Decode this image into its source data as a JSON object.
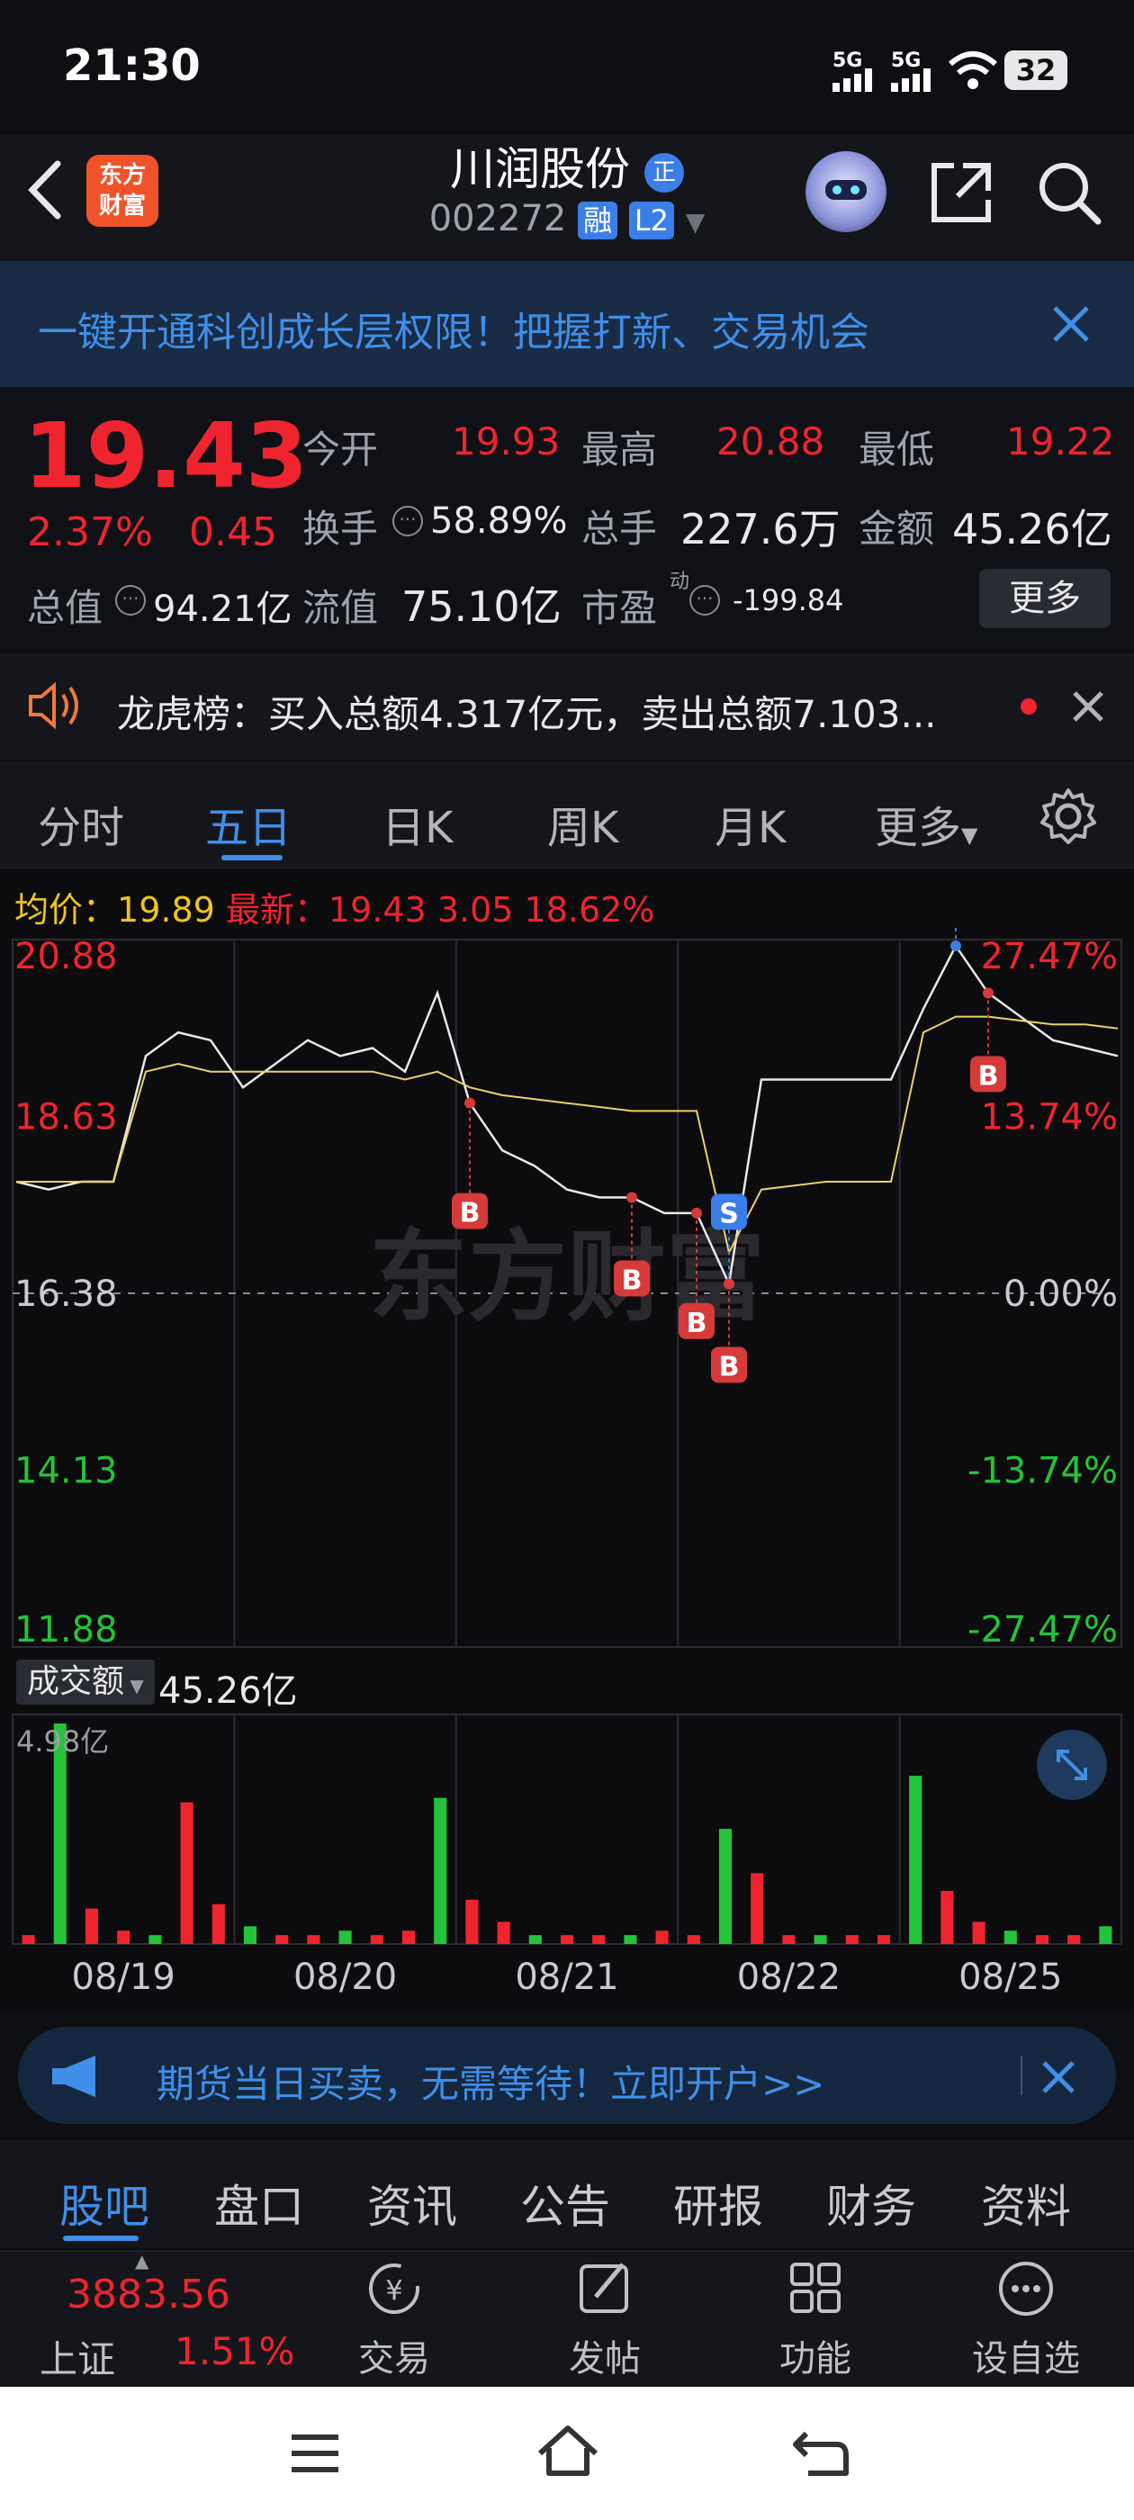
{
  "status": {
    "time": "21:30",
    "battery": "32",
    "net1": "5G",
    "net2": "5G"
  },
  "header": {
    "logo_line1": "东方",
    "logo_line2": "财富",
    "title": "川润股份",
    "title_badge": "正",
    "code": "002272",
    "tag_rong": "融",
    "tag_l2": "L2"
  },
  "banner": {
    "text": "一键开通科创成长层权限！把握打新、交易机会"
  },
  "quote": {
    "price": "19.43",
    "change_pct": "2.37%",
    "change": "0.45",
    "open_label": "今开",
    "open": "19.93",
    "high_label": "最高",
    "high": "20.88",
    "low_label": "最低",
    "low": "19.22",
    "turnover_label": "换手",
    "turnover": "58.89%",
    "volume_label": "总手",
    "volume": "227.6万",
    "amount_label": "金额",
    "amount": "45.26亿",
    "mktcap_label": "总值",
    "mktcap": "94.21亿",
    "float_label": "流值",
    "float": "75.10亿",
    "pe_label": "市盈",
    "pe_sup": "动",
    "pe": "-199.84",
    "more_label": "更多"
  },
  "notice": {
    "text": "龙虎榜：买入总额4.317亿元，卖出总额7.103..."
  },
  "tabs": [
    "分时",
    "五日",
    "日K",
    "周K",
    "月K",
    "更多"
  ],
  "chart_info": {
    "avg_label": "均价：",
    "avg": "19.89",
    "last_label": "最新：",
    "last": "19.43",
    "chg": "3.05",
    "chg_pct": "18.62%"
  },
  "chart_data": {
    "type": "line",
    "title": "",
    "y_left_ticks": [
      "20.88",
      "18.63",
      "16.38",
      "14.13",
      "11.88"
    ],
    "y_right_ticks": [
      "27.47%",
      "13.74%",
      "0.00%",
      "-13.74%",
      "-27.47%"
    ],
    "x_labels": [
      "08/19",
      "08/20",
      "08/21",
      "08/22",
      "08/25"
    ],
    "ylim": [
      11.88,
      20.88
    ],
    "reference_price": 16.38,
    "series": [
      {
        "values": [
          17.8,
          17.7,
          17.8,
          17.8,
          19.4,
          19.7,
          19.6,
          19.0,
          19.3,
          19.6,
          19.4,
          19.5,
          19.2,
          20.2,
          18.8,
          18.2,
          18.0,
          17.7,
          17.6,
          17.6,
          17.4,
          17.4,
          16.5,
          19.1,
          19.1,
          19.1,
          19.1,
          19.1,
          20.0,
          20.8,
          20.2,
          19.9,
          19.6,
          19.5,
          19.4
        ]
      },
      {
        "values": [
          17.8,
          17.8,
          17.8,
          17.8,
          19.2,
          19.3,
          19.2,
          19.2,
          19.2,
          19.2,
          19.2,
          19.2,
          19.1,
          19.2,
          19.0,
          18.9,
          18.85,
          18.8,
          18.75,
          18.7,
          18.7,
          18.7,
          16.9,
          17.7,
          17.75,
          17.8,
          17.8,
          17.8,
          19.7,
          19.9,
          19.9,
          19.85,
          19.8,
          19.8,
          19.75
        ]
      }
    ],
    "volume_label": "成交额",
    "volume_total": "45.26亿",
    "volume_max": "4.98亿",
    "volume_values": [
      0.2,
      4.98,
      0.8,
      0.3,
      0.2,
      3.2,
      0.9,
      0.4,
      0.2,
      0.2,
      0.3,
      0.2,
      0.3,
      3.3,
      1.0,
      0.5,
      0.2,
      0.2,
      0.2,
      0.2,
      0.3,
      0.2,
      2.6,
      1.6,
      0.2,
      0.2,
      0.2,
      0.2,
      3.8,
      1.2,
      0.5,
      0.3,
      0.2,
      0.2,
      0.4
    ],
    "markers": [
      "S",
      "B",
      "B",
      "B",
      "B",
      "S",
      "B"
    ]
  },
  "ad": {
    "text": "期货当日买卖，无需等待！立即开户>>"
  },
  "subtabs": [
    "股吧",
    "盘口",
    "资讯",
    "公告",
    "研报",
    "财务",
    "资料"
  ],
  "dock": {
    "index_value": "3883.56",
    "index_name": "上证",
    "index_pct": "1.51%",
    "trade": "交易",
    "post": "发帖",
    "func": "功能",
    "watch": "设自选"
  },
  "watermark": "东方财富"
}
